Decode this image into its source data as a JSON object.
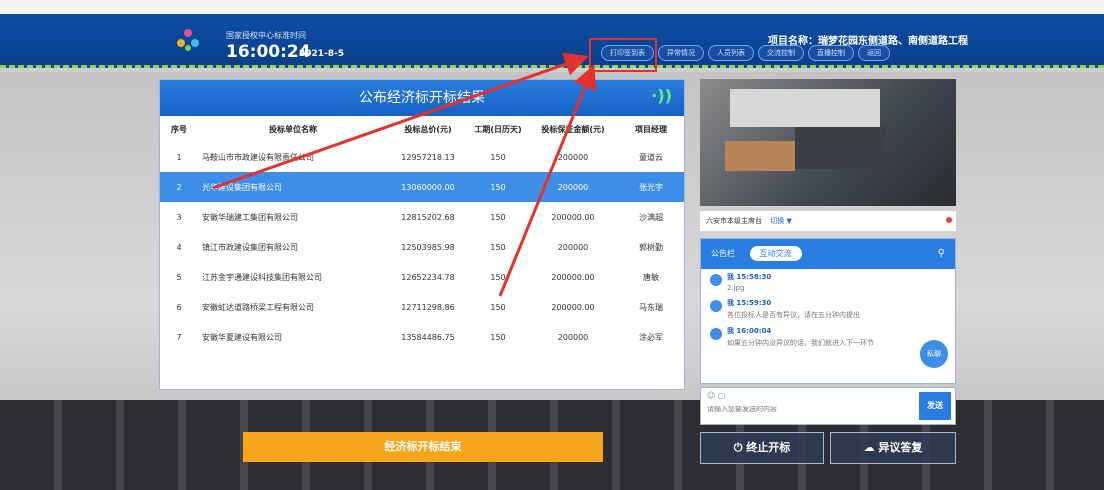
{
  "header": {
    "time_caption": "国家授权中心标准时间",
    "clock": "16:00:24",
    "date": "2021-8-5",
    "project_label": "项目名称：",
    "project_name": "瑞梦花园东侧道路、南侧道路工程",
    "nav": [
      "打印签到表",
      "异常情况",
      "人员列表",
      "交流控制",
      "直播控制",
      "返回"
    ]
  },
  "result_panel": {
    "title": "公布经济标开标结果",
    "columns": [
      "序号",
      "投标单位名称",
      "投标总价(元)",
      "工期(日历天)",
      "投标保证金额(元)",
      "项目经理"
    ],
    "rows": [
      [
        "1",
        "马鞍山市市政建设有限责任公司",
        "12957218.13",
        "150",
        "200000",
        "童道云"
      ],
      [
        "2",
        "光华建设集团有限公司",
        "13060000.00",
        "150",
        "200000",
        "张光宇"
      ],
      [
        "3",
        "安徽华瑞建工集团有限公司",
        "12815202.68",
        "150",
        "200000.00",
        "沙满超"
      ],
      [
        "4",
        "镇江市政建设集团有限公司",
        "12503985.98",
        "150",
        "200000",
        "郭树勤"
      ],
      [
        "5",
        "江苏金宇通建设科技集团有限公司",
        "12652234.78",
        "150",
        "200000.00",
        "唐敏"
      ],
      [
        "6",
        "安徽虹达道路桥梁工程有限公司",
        "12711298.86",
        "150",
        "200000.00",
        "马东瑞"
      ],
      [
        "7",
        "安徽华夏建设有限公司",
        "13584486.75",
        "150",
        "200000",
        "涂必军"
      ]
    ],
    "selected_row": 2,
    "end_button": "经济标开标结束"
  },
  "room": {
    "name": "六安市本级主席台",
    "switch_label": "切换"
  },
  "chat": {
    "tab_board": "公告栏",
    "tab_interactive": "互动交流",
    "messages": [
      {
        "time": "我 15:58:30",
        "text": "2.jpg"
      },
      {
        "time": "我 15:59:30",
        "text": "各位投标人是否有异议，请在五分钟内提出"
      },
      {
        "time": "我 16:00:04",
        "text": "如果五分钟内没异议的话，我们就进入下一环节"
      }
    ],
    "private_btn": "私聊",
    "input_placeholder": "请输入您要发送的内容",
    "send_label": "发送"
  },
  "actions": {
    "stop": "终止开标",
    "objection": "异议答复"
  },
  "colors": {
    "header_bg": "#0d4ea5",
    "accent_blue": "#2a7de0",
    "end_button": "#f7a51a",
    "annotation_red": "#e5312d"
  }
}
